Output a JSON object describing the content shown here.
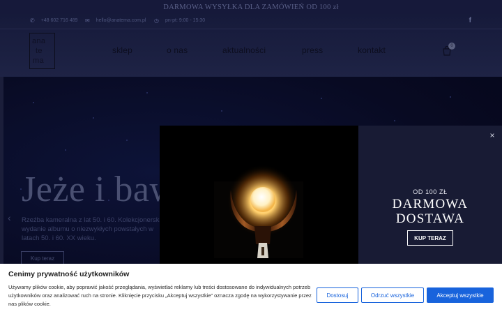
{
  "announcement": {
    "text": "DARMOWA WYSYŁKA DLA ZAMÓWIEŃ OD 100 zł"
  },
  "contact": {
    "phone": "+48 602 716 489",
    "email": "hello@anatema.com.pl",
    "hours": "pn-pt: 9:00 - 15:30"
  },
  "logo": {
    "line1": "ana",
    "line2": "te",
    "line3": "ma"
  },
  "nav": {
    "items": [
      "sklep",
      "o nas",
      "aktualności",
      "press",
      "kontakt"
    ]
  },
  "cart": {
    "count": "0"
  },
  "hero": {
    "title": "Jeże i baw",
    "subtitle": "Rzeźba kameralna z lat 50. i 60. Kolekcjonerskie wydanie albumu o niezwykłych powstałych w latach 50. i 60. XX wieku.",
    "button": "Kup teraz"
  },
  "popup": {
    "close": "×",
    "small": "OD 100 ZŁ",
    "big_line1": "DARMOWA",
    "big_line2": "DOSTAWA",
    "button": "KUP TERAZ"
  },
  "cookie": {
    "title": "Cenimy prywatność użytkowników",
    "text": "Używamy plików cookie, aby poprawić jakość przeglądania, wyświetlać reklamy lub treści dostosowane do indywidualnych potrzeb użytkowników oraz analizować ruch na stronie. Kliknięcie przycisku „Akceptuj wszystkie” oznacza zgodę na wykorzystywanie przez nas plików cookie.",
    "customize": "Dostosuj",
    "reject": "Odrzuć wszystkie",
    "accept": "Akceptuj wszystkie"
  },
  "colors": {
    "accent": "#1863dc",
    "navy": "#181b34"
  }
}
